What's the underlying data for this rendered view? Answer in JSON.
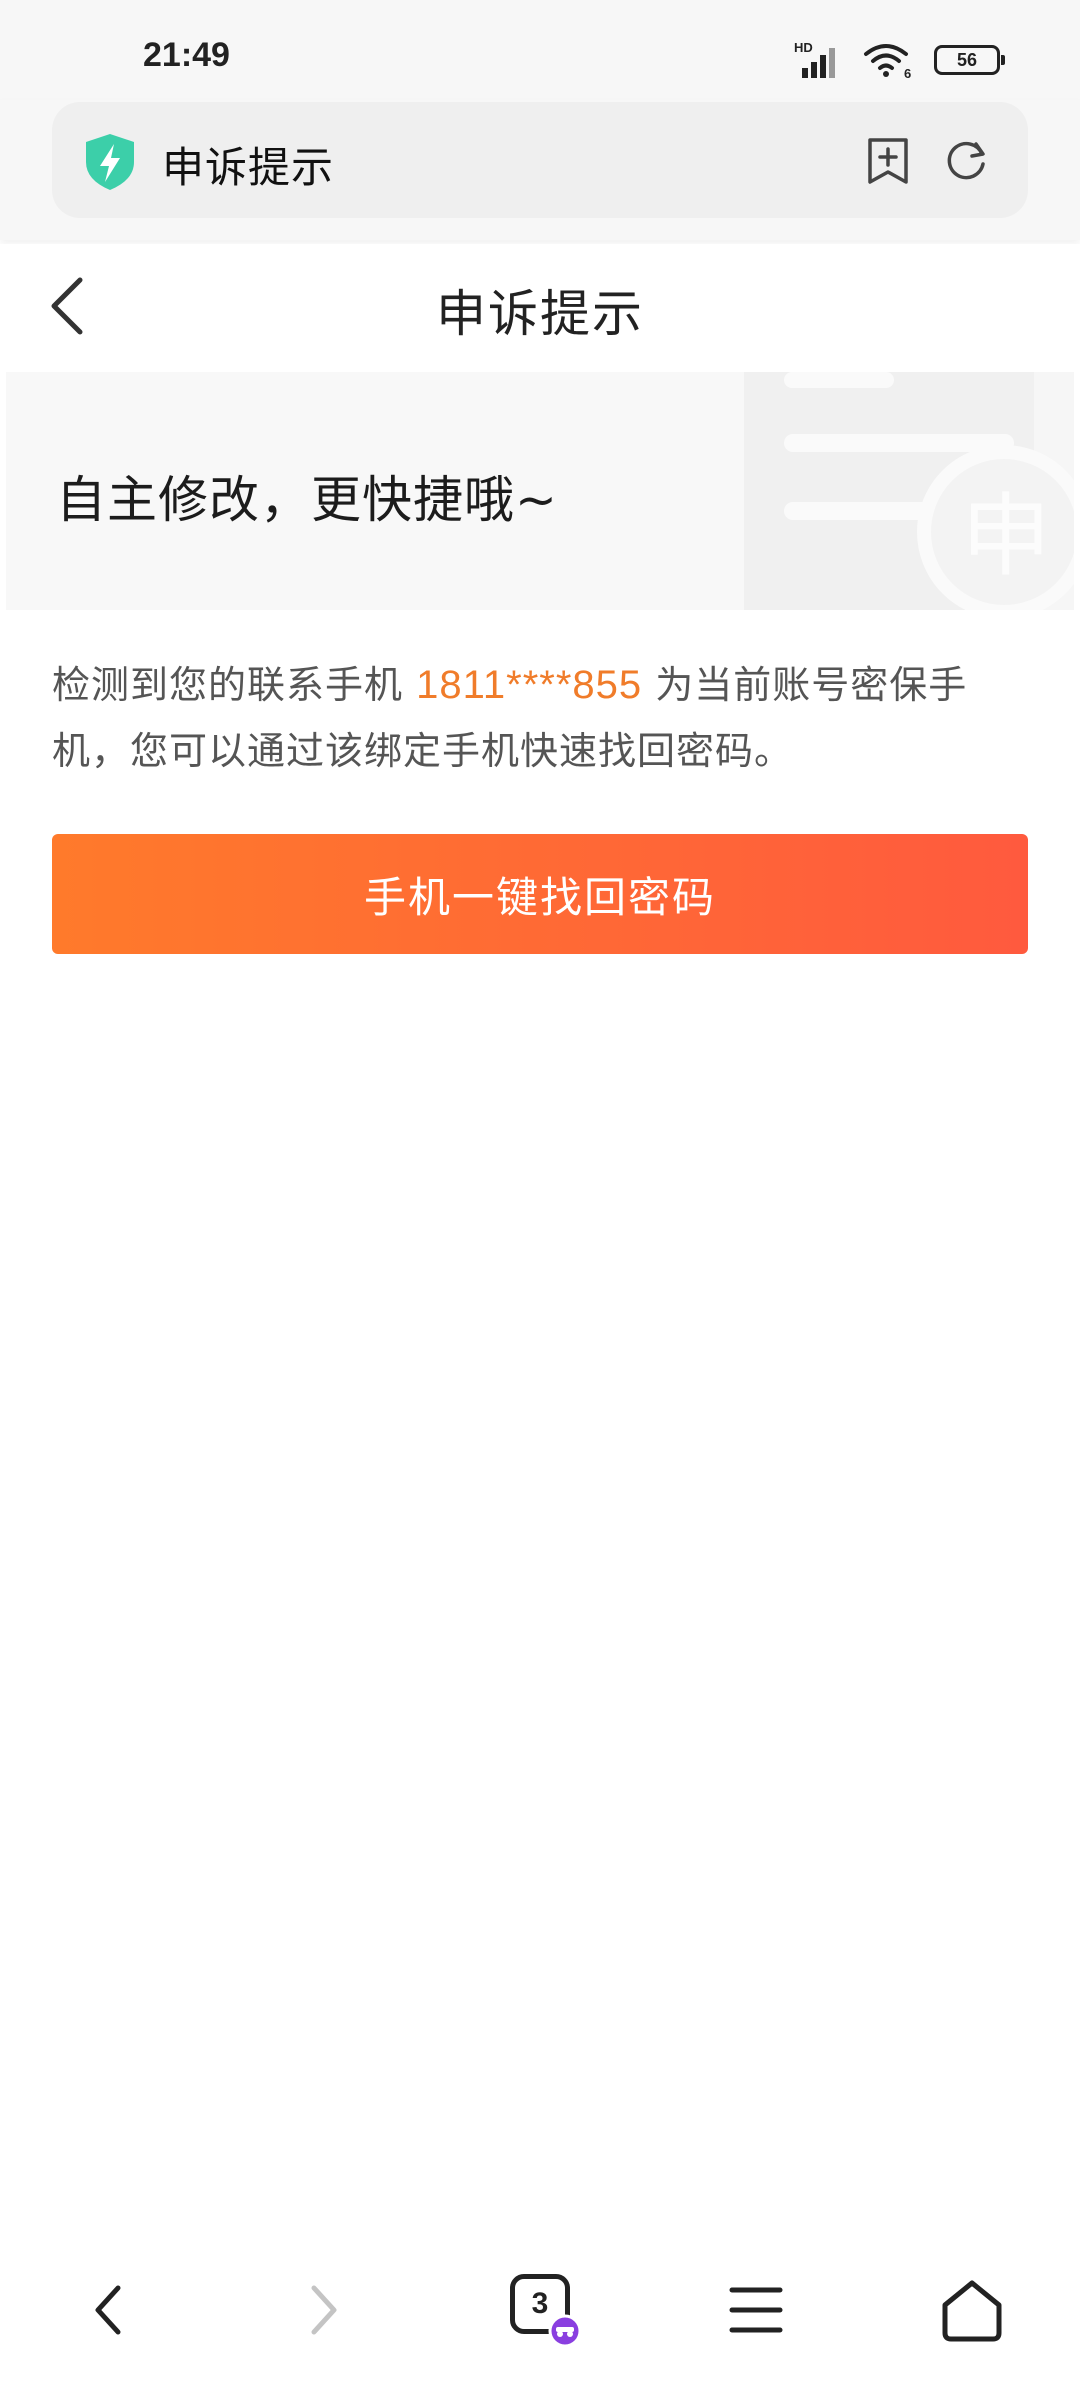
{
  "status_bar": {
    "time": "21:49",
    "network_label": "HD",
    "wifi_badge": "6",
    "battery_level": "56"
  },
  "address_bar": {
    "title": "申诉提示",
    "security_icon": "shield-lightning-icon",
    "bookmark_icon": "bookmark-add-icon",
    "refresh_icon": "refresh-icon",
    "accent_color": "#3ccfa9"
  },
  "header": {
    "title": "申诉提示",
    "back_icon": "chevron-left-icon"
  },
  "banner": {
    "text": "自主修改，更快捷哦~",
    "watermark_char": "申"
  },
  "description": {
    "prefix": "检测到您的联系手机",
    "phone": "1811****855",
    "suffix": "为当前账号密保手机，您可以通过该绑定手机快速找回密码。",
    "phone_color": "#f07c2a"
  },
  "primary_button": {
    "label": "手机一键找回密码",
    "gradient_start": "#ff7a2b",
    "gradient_end": "#ff5a3e"
  },
  "bottom_nav": {
    "tab_count": "3",
    "items": [
      "back-icon",
      "forward-icon",
      "tabs-icon",
      "menu-icon",
      "home-icon"
    ]
  }
}
